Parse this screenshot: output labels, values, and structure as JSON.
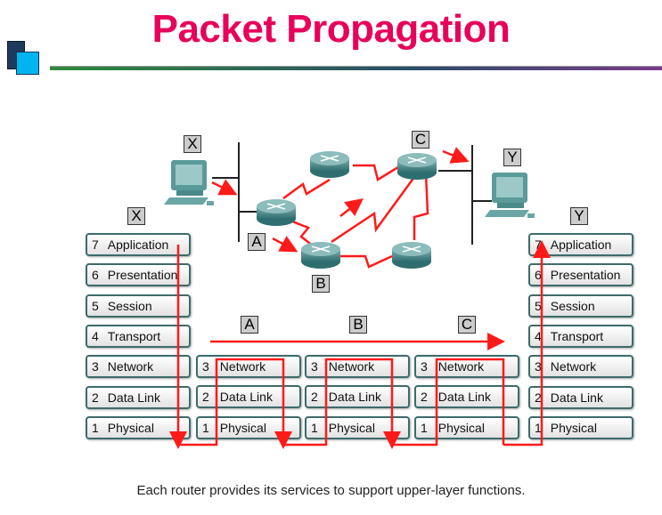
{
  "title": "Packet Propagation",
  "caption": "Each router provides its services to support upper-layer functions.",
  "colors": {
    "title": "#e8005a",
    "path": "#ff1a1a",
    "device": "#4a8a8a"
  },
  "labels": {
    "x_top": "X",
    "x_stack": "X",
    "y_top": "Y",
    "y_stack": "Y",
    "a_net": "A",
    "b_net": "B",
    "c_net": "C",
    "a_row": "A",
    "b_row": "B",
    "c_row": "C"
  },
  "host_stack_x": [
    {
      "num": "7",
      "name": "Application"
    },
    {
      "num": "6",
      "name": "Presentation"
    },
    {
      "num": "5",
      "name": "Session"
    },
    {
      "num": "4",
      "name": "Transport"
    },
    {
      "num": "3",
      "name": "Network"
    },
    {
      "num": "2",
      "name": "Data Link"
    },
    {
      "num": "1",
      "name": "Physical"
    }
  ],
  "router_stack": [
    {
      "num": "3",
      "name": "Network"
    },
    {
      "num": "2",
      "name": "Data Link"
    },
    {
      "num": "1",
      "name": "Physical"
    }
  ],
  "host_stack_y": [
    {
      "num": "7",
      "name": "Application"
    },
    {
      "num": "6",
      "name": "Presentation"
    },
    {
      "num": "5",
      "name": "Session"
    },
    {
      "num": "4",
      "name": "Transport"
    },
    {
      "num": "3",
      "name": "Network"
    },
    {
      "num": "2",
      "name": "Data Link"
    },
    {
      "num": "1",
      "name": "Physical"
    }
  ]
}
